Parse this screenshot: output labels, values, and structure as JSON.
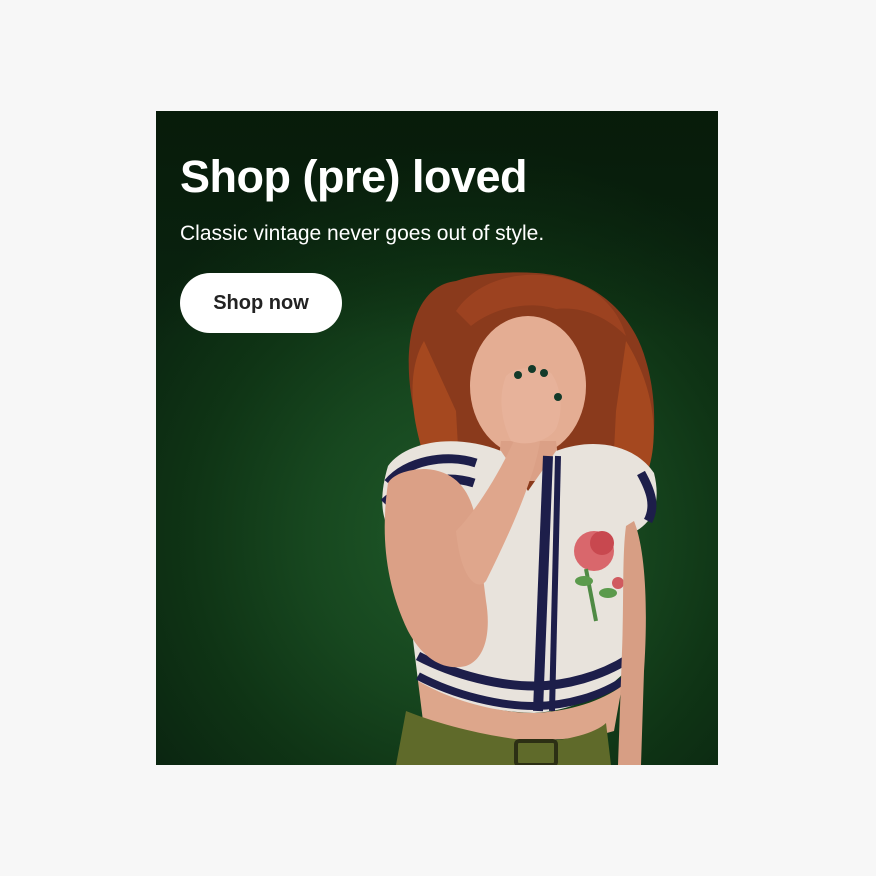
{
  "promo": {
    "headline": "Shop (pre) loved",
    "subhead": "Classic vintage never goes out of style.",
    "cta_label": "Shop now"
  },
  "colors": {
    "page_background": "#f7f7f7",
    "banner_background": "#17471f",
    "button_background": "#ffffff",
    "button_text": "#222222",
    "text": "#ffffff"
  },
  "icons": {
    "photo": "model-photo"
  }
}
